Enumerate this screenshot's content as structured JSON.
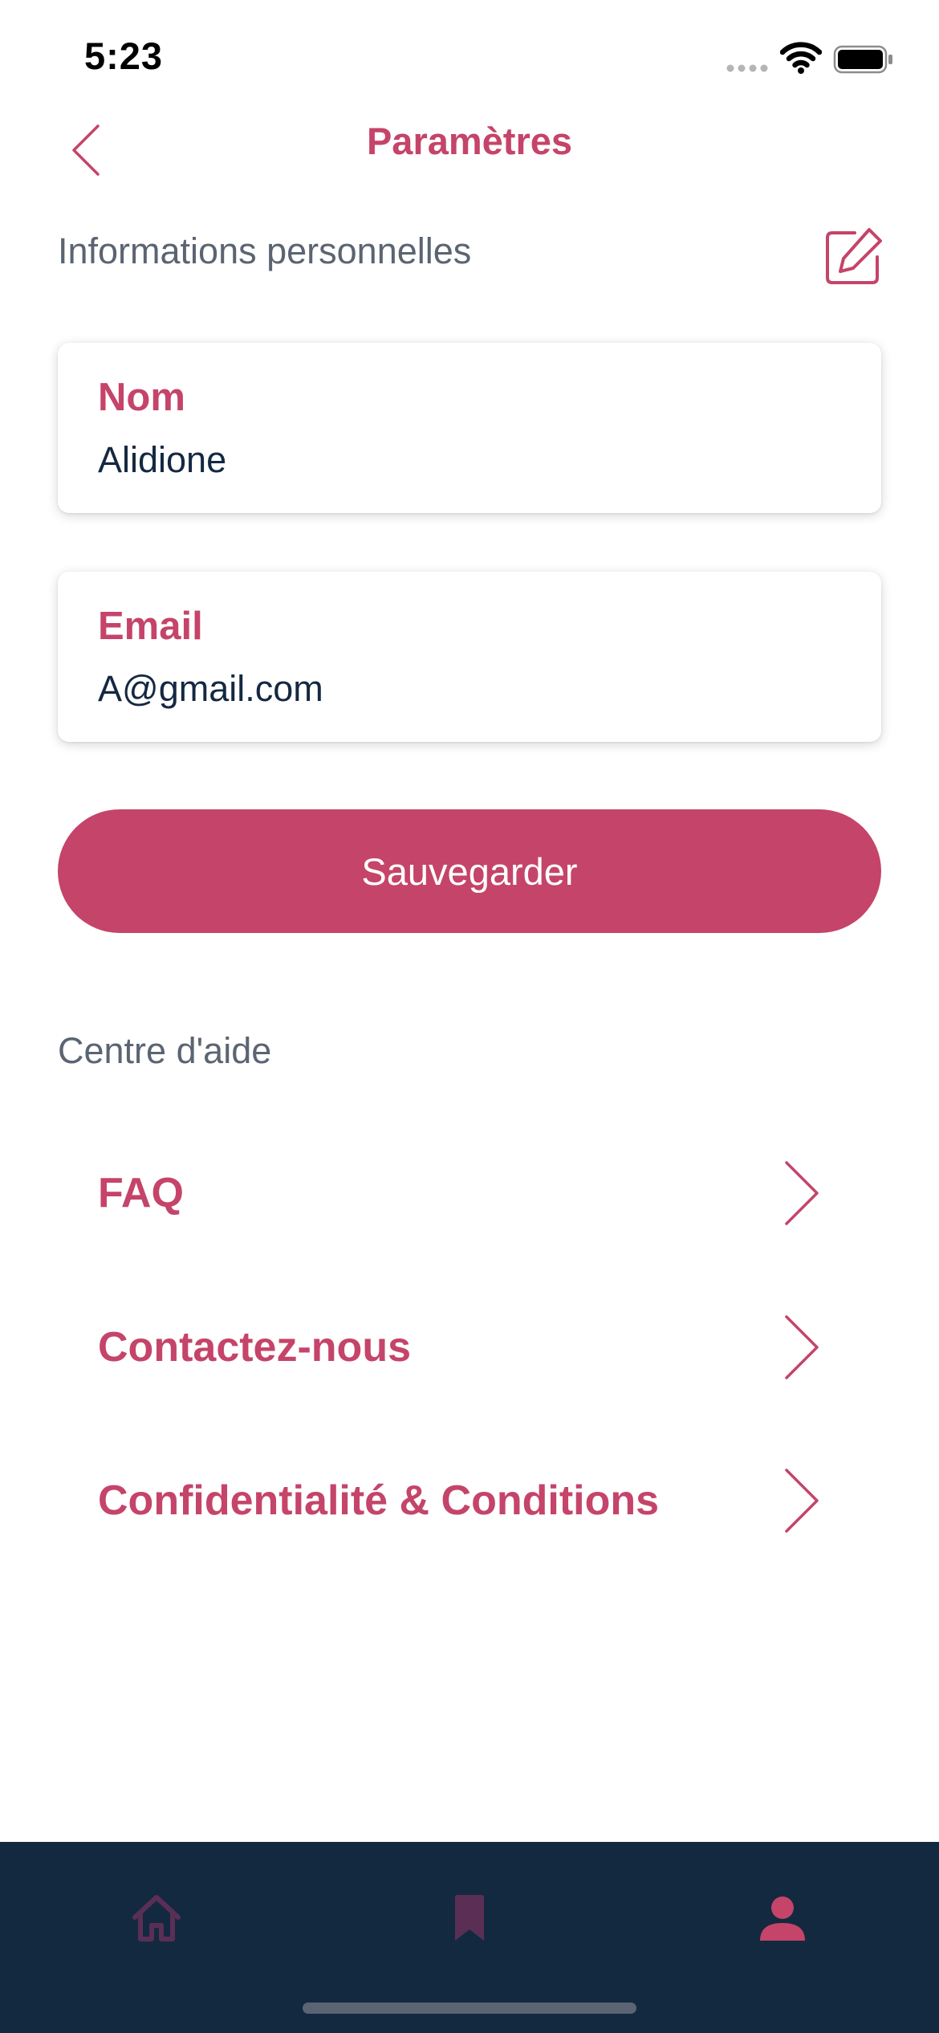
{
  "status_bar": {
    "time": "5:23",
    "icons": [
      "signal-icon",
      "wifi-icon",
      "battery-icon"
    ]
  },
  "header": {
    "title": "Paramètres",
    "back_icon": "chevron-left-icon"
  },
  "personal_info": {
    "section_label": "Informations personnelles",
    "edit_icon": "edit-icon",
    "fields": [
      {
        "label": "Nom",
        "value": "Alidione"
      },
      {
        "label": "Email",
        "value": "A@gmail.com"
      }
    ],
    "save_label": "Sauvegarder"
  },
  "help_center": {
    "section_label": "Centre d'aide",
    "items": [
      {
        "label": "FAQ"
      },
      {
        "label": "Contactez-nous"
      },
      {
        "label": "Confidentialité & Conditions"
      }
    ]
  },
  "tab_bar": {
    "tabs": [
      {
        "icon": "home-icon",
        "active": false
      },
      {
        "icon": "bookmark-icon",
        "active": false
      },
      {
        "icon": "profile-icon",
        "active": true
      }
    ]
  },
  "colors": {
    "accent": "#c54469",
    "text_dark": "#142842",
    "text_muted": "#5b6472",
    "tab_bar_bg": "#132940",
    "tab_inactive": "#5b2f55"
  }
}
